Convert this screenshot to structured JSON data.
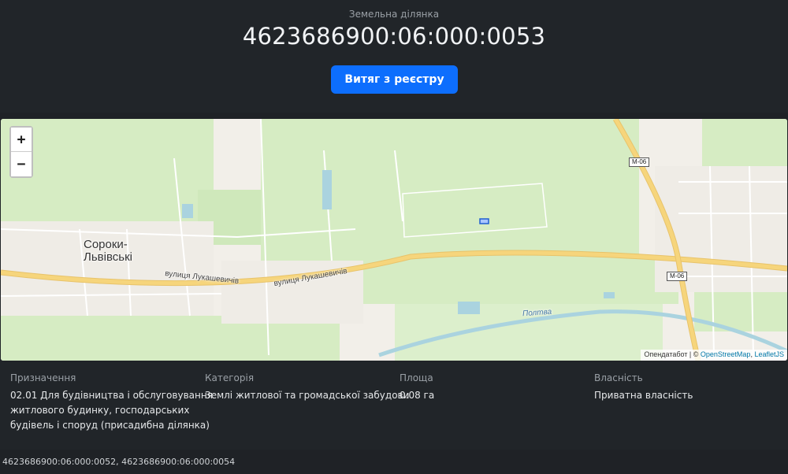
{
  "header": {
    "subtitle": "Земельна ділянка",
    "cadastral_number": "4623686900:06:000:0053",
    "extract_button": "Витяг з реєстру"
  },
  "map": {
    "zoom_in": "+",
    "zoom_out": "−",
    "place_label_line1": "Сороки-",
    "place_label_line2": "Львівські",
    "street_label_1": "вулиця Лукашевичів",
    "street_label_2": "вулиця Лукашевичів",
    "road_shield_1": "М-06",
    "road_shield_2": "М-06",
    "river_label": "Полтва",
    "attribution_prefix": "Опендатабот | © ",
    "attribution_link1": "OpenStreetMap",
    "attribution_sep": ", ",
    "attribution_link2": "LeafletJS",
    "colors": {
      "highway": "#f6d57c",
      "green": "#d6ecc3",
      "water": "#aad3df",
      "parcel": "#1f5fd1"
    }
  },
  "info": {
    "purpose_label": "Призначення",
    "purpose_line1": "02.01 Для будівництва і обслуговування",
    "purpose_line2": "житлового будинку, господарських",
    "purpose_line3": "будівель і споруд (присадибна ділянка)",
    "category_label": "Категорія",
    "category_value": "Землі житлової та громадської забудови",
    "area_label": "Площа",
    "area_value": "0.08 га",
    "ownership_label": "Власність",
    "ownership_value": "Приватна власність"
  },
  "footer": {
    "neighbors": "4623686900:06:000:0052, 4623686900:06:000:0054"
  }
}
